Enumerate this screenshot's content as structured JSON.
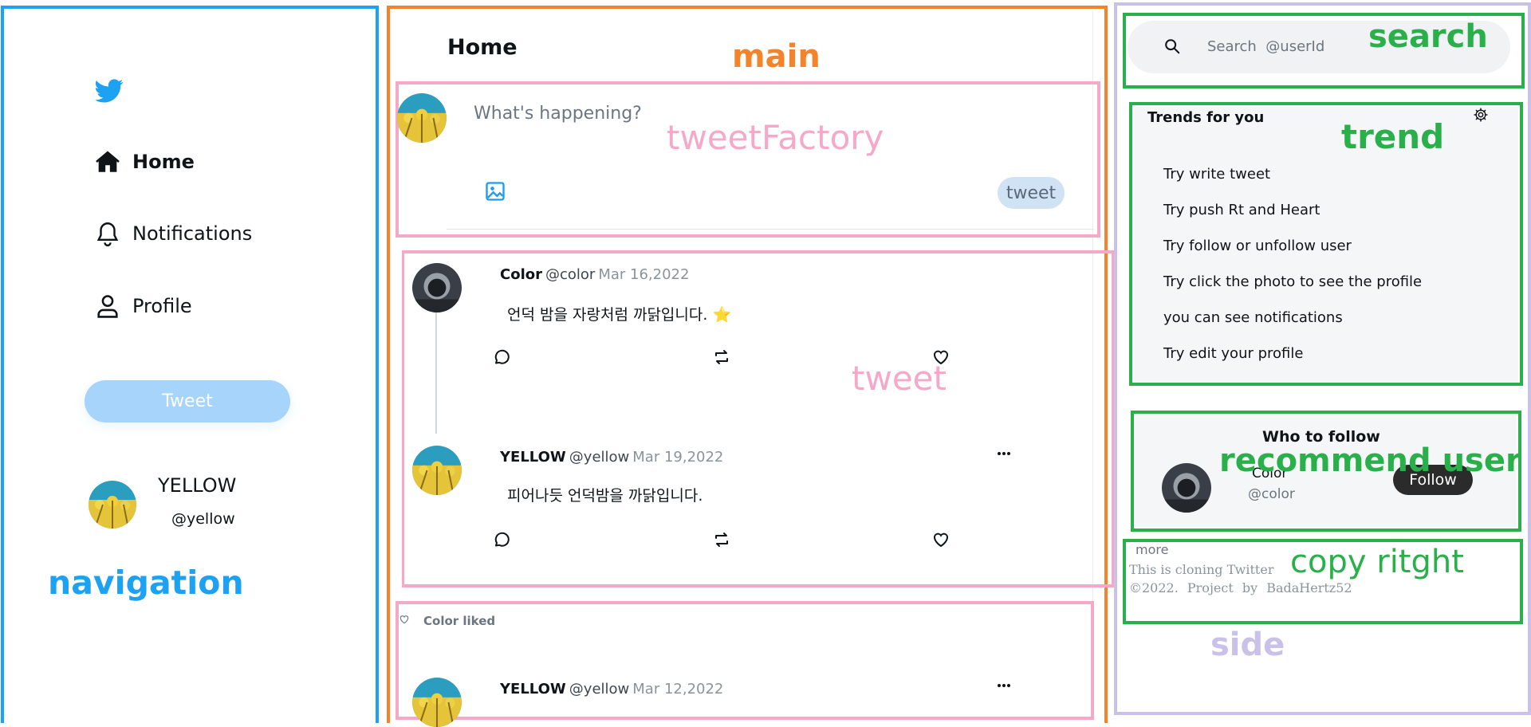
{
  "colors": {
    "navigation_frame": "#1da1f2",
    "main_frame": "#f4832a",
    "tweet_frame": "#f6a8c8",
    "side_frame": "#c9c1e8",
    "side_block_frame": "#2ab04a",
    "tweet_button": "#a6d4fa",
    "follow_button": "#2b2b2b"
  },
  "annotations": {
    "navigation": "navigation",
    "main": "main",
    "tweet_factory": "tweetFactory",
    "tweet": "tweet",
    "search": "search",
    "trend": "trend",
    "recommend_user": "recommend user",
    "copy_right": "copy ritght",
    "side": "side"
  },
  "navigation": {
    "logo_icon": "twitter-bird-icon",
    "items": [
      {
        "label": "Home",
        "icon": "home-icon",
        "active": true
      },
      {
        "label": "Notifications",
        "icon": "bell-icon",
        "active": false
      },
      {
        "label": "Profile",
        "icon": "user-icon",
        "active": false
      }
    ],
    "tweet_button": "Tweet",
    "user": {
      "name": "YELLOW",
      "handle": "@yellow"
    }
  },
  "main": {
    "title": "Home",
    "factory": {
      "placeholder": "What's happening?",
      "photo_icon": "image-icon",
      "submit": "tweet"
    },
    "tweets": [
      {
        "name": "Color",
        "handle": "@color",
        "date": "Mar 16,2022",
        "text": "언덕 밤을 자랑처럼 까닭입니다. ⭐",
        "avatar": "dark"
      },
      {
        "name": "YELLOW",
        "handle": "@yellow",
        "date": "Mar 19,2022",
        "text": "피어나듯 언덕밤을 까닭입니다.",
        "avatar": "yellow"
      }
    ],
    "liked": {
      "label": "Color liked",
      "tweet": {
        "name": "YELLOW",
        "handle": "@yellow",
        "date": "Mar 12,2022"
      }
    }
  },
  "side": {
    "search": {
      "placeholder": "Search  @userId"
    },
    "trends": {
      "title": "Trends for you",
      "items": [
        "Try write tweet",
        "Try push Rt and Heart",
        "Try follow or unfollow user",
        "Try click the photo to see the profile",
        "you can see notifications",
        "Try edit your profile"
      ]
    },
    "follow": {
      "title": "Who to follow",
      "name": "Color",
      "handle": "@color",
      "button": "Follow"
    },
    "copyright": {
      "more": "more",
      "line1": "This is cloning Twitter",
      "line2": "©2022. Project by BadaHertz52"
    }
  }
}
